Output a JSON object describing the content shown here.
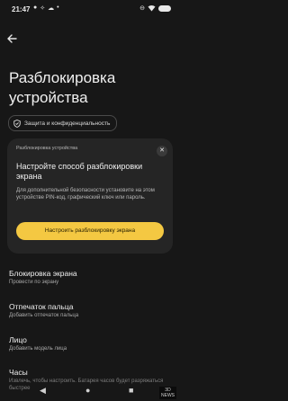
{
  "status": {
    "time": "21:47"
  },
  "header": {
    "title": "Разблокировка устройства"
  },
  "chip": {
    "label": "Защита и конфиденциальность"
  },
  "card": {
    "label": "Разблокировка устройства",
    "title": "Настройте способ разблокировки экрана",
    "description": "Для дополнительной безопасности установите на этом устройстве PIN-код, графический ключ или пароль.",
    "button": "Настроить разблокировку экрана"
  },
  "items": [
    {
      "title": "Блокировка экрана",
      "subtitle": "Провести по экрану"
    },
    {
      "title": "Отпечаток пальца",
      "subtitle": "Добавить отпечаток пальца"
    },
    {
      "title": "Лицо",
      "subtitle": "Добавить модель лица"
    },
    {
      "title": "Часы",
      "subtitle": "Извлечь, чтобы настроить. Батарея часов будет разряжаться быстрее"
    }
  ],
  "watermark": {
    "line1": "3D",
    "line2": "NEWS"
  }
}
